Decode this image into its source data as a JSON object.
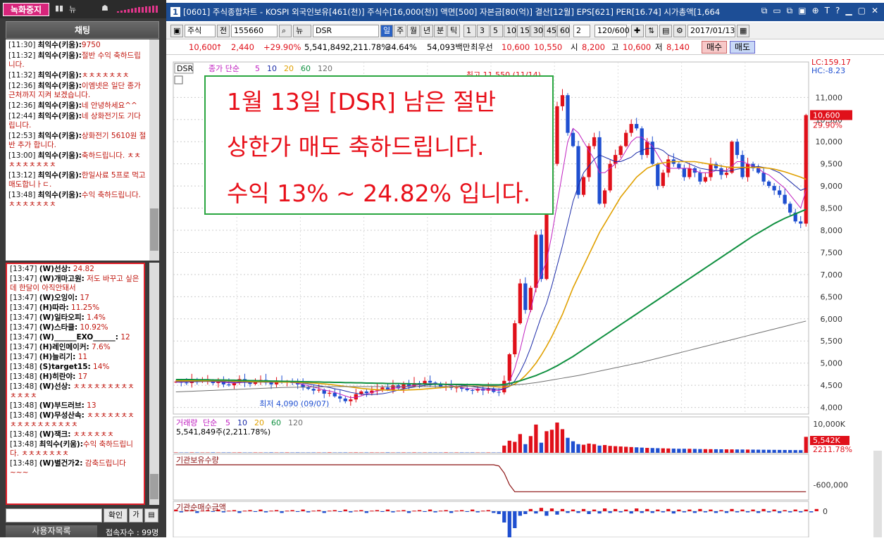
{
  "left_panel": {
    "record_button": "녹화중지",
    "top_icons": [
      "▮▮",
      "뉴",
      "☗"
    ],
    "chat_header": "채팅",
    "chat_messages": [
      {
        "time": "[11:30]",
        "name": "최익수(키움):",
        "text": "9750"
      },
      {
        "time": "[11:32]",
        "name": "최익수(키움):",
        "text": "절반 수익 축하드립니다."
      },
      {
        "time": "[11:32]",
        "name": "최익수(키움):",
        "text": "ㅊㅊㅊㅊㅊㅊㅊ"
      },
      {
        "time": "[12:36]",
        "name": "최익수(키움):",
        "text": "이엠넷은 일단 종가 근처까지 지켜 보겠습니다."
      },
      {
        "time": "[12:36]",
        "name": "최익수(키움):",
        "text": "네 안녕하세요^^"
      },
      {
        "time": "[12:44]",
        "name": "최익수(키움):",
        "text": "네 상화전기도 기다립니다."
      },
      {
        "time": "[12:53]",
        "name": "최익수(키움):",
        "text": "상화전기 5610원 절반 추가 합니다."
      },
      {
        "time": "[13:00]",
        "name": "최익수(키움):",
        "text": "축하드립니다. ㅊㅊㅊㅊㅊㅊㅊㅊㅊ"
      },
      {
        "time": "[13:12]",
        "name": "최익수(키움):",
        "text": "한일사료 5프로 먹고 매도합니ㅏㄷ."
      },
      {
        "time": "[13:48]",
        "name": "최익수(키움):",
        "text": "수익 축하드립니다. ㅊㅊㅊㅊㅊㅊㅊ"
      }
    ],
    "user_messages": [
      {
        "time": "[13:47]",
        "name": "(W)선상:",
        "text": " 24.82"
      },
      {
        "time": "[13:47]",
        "name": "(W)개마고원:",
        "text": " 저도 바꾸고 싶은데 한달이 아직안돼서"
      },
      {
        "time": "[13:47]",
        "name": "(W)오잉이:",
        "text": " 17"
      },
      {
        "time": "[13:47]",
        "name": "(H)따라:",
        "text": " 11.25%"
      },
      {
        "time": "[13:47]",
        "name": "(W)일타오피:",
        "text": " 1.4%"
      },
      {
        "time": "[13:47]",
        "name": "(W)스타클:",
        "text": " 10.92%"
      },
      {
        "time": "[13:47]",
        "name": "(W)______EXO______:",
        "text": " 12"
      },
      {
        "time": "[13:47]",
        "name": "(H)레인메이커:",
        "text": " 7.6%"
      },
      {
        "time": "[13:47]",
        "name": "(H)늘리기:",
        "text": " 11"
      },
      {
        "time": "[13:48]",
        "name": "(S)target15:",
        "text": " 14%"
      },
      {
        "time": "[13:48]",
        "name": "(H)히란야:",
        "text": " 17"
      },
      {
        "time": "[13:48]",
        "name": "(W)선상:",
        "text": " ㅊㅊㅊㅊㅊㅊㅊㅊㅊㅊㅊㅊㅊ"
      },
      {
        "time": "[13:48]",
        "name": "(W)부드러브:",
        "text": " 13"
      },
      {
        "time": "[13:48]",
        "name": "(W)무성산속:",
        "text": " ㅊㅊㅊㅊㅊㅊㅊㅊㅊㅊㅊㅊㅊㅊㅊㅊㅊ"
      },
      {
        "time": "[13:48]",
        "name": "(W)잭크:",
        "text": " ㅊㅊㅊㅊㅊㅊ"
      },
      {
        "time": "[13:48]",
        "name": "최익수(키움):",
        "text": "수익 축하드립니다. ㅊㅊㅊㅊㅊㅊㅊ",
        "red": true
      },
      {
        "time": "[13:48]",
        "name": "(W)별건가2:",
        "text": " 감축드립니다~~~"
      }
    ],
    "confirm_button": "확인",
    "small_buttons": [
      "가",
      "▤"
    ],
    "user_list_button": "사용자목록",
    "connection_count": "접속자수 : 99명"
  },
  "window": {
    "num": "1",
    "title": "[0601] 주식종합차트 - KOSPI 외국인보유[461(천)] 주식수[16,000(천)] 액면[500] 자본금[80(억)] 결산[12월] EPS[621] PER[16.74] 시가총액[1,664",
    "controls": [
      "⧉",
      "▭",
      "⧉",
      "▣",
      "⊕",
      "T",
      "?",
      "▁",
      "▢",
      "✕"
    ]
  },
  "toolbar": {
    "type_select": "주식",
    "jeon": "전",
    "code": "155660",
    "name": "DSR",
    "periods": [
      "일",
      "주",
      "월",
      "년",
      "분",
      "틱"
    ],
    "intervals": [
      "1",
      "3",
      "5",
      "10",
      "15",
      "30",
      "45",
      "60"
    ],
    "count_select": "2",
    "range": "120/600",
    "date": "2017/01/13"
  },
  "pricebar": {
    "price": "10,600",
    "arrow": "↑",
    "change": "2,440",
    "change_pct": "+29.90%",
    "volume": "5,541,849",
    "vol2": "2,211.78%",
    "vol3": "34.64%",
    "amount": "54,093백만",
    "best_ask_label": "최우선",
    "best_ask": "10,600",
    "best_bid": "10,550",
    "open_label": "시",
    "open": "8,200",
    "high_label": "고",
    "high": "10,600",
    "low_label": "저",
    "low": "8,140",
    "buy": "매수",
    "sell": "매도"
  },
  "callout": {
    "line1": "1월 13일 [DSR] 남은 절반",
    "line2": "상한가 매도 축하드립니다.",
    "line3": "수익 13% ~ 24.82% 입니다."
  },
  "chart_data": {
    "type": "candlestick",
    "symbol_tag": "DSR",
    "legend_label": "종가 단순",
    "ma_periods": [
      "5",
      "10",
      "20",
      "60",
      "120"
    ],
    "ma_colors": [
      "#c020c0",
      "#1a2aa8",
      "#e0a000",
      "#109040",
      "#707070"
    ],
    "price_ticks": [
      "11,000",
      "10,500",
      "10,000",
      "9,500",
      "9,000",
      "8,500",
      "8,000",
      "7,500",
      "7,000",
      "6,500",
      "6,000",
      "5,500",
      "5,000",
      "4,500",
      "4,000"
    ],
    "price_ylim": [
      3850,
      11800
    ],
    "high_annotation": "최고 11,550 (11/14)",
    "low_annotation": "최저 4,090 (09/07)",
    "lc_label": "LC:159.17",
    "hc_label": "HC:-8.23",
    "last_price_label": "10,600",
    "last_pct_label": "29.90%",
    "closes": [
      4580,
      4560,
      4550,
      4620,
      4580,
      4600,
      4610,
      4550,
      4600,
      4520,
      4500,
      4560,
      4640,
      4560,
      4530,
      4590,
      4620,
      4560,
      4520,
      4600,
      4560,
      4590,
      4550,
      4520,
      4450,
      4420,
      4380,
      4400,
      4310,
      4330,
      4250,
      4200,
      4140,
      4180,
      4300,
      4360,
      4320,
      4380,
      4410,
      4450,
      4400,
      4500,
      4430,
      4520,
      4480,
      4550,
      4520,
      4600,
      4560,
      4510,
      4460,
      4480,
      4440,
      4450,
      4420,
      4390,
      4380,
      4420,
      4380,
      4420,
      4350,
      4340,
      4600,
      5200,
      5900,
      6800,
      6200,
      6700,
      7900,
      6900,
      8500,
      9500,
      10800,
      11050,
      10200,
      9900,
      8800,
      9200,
      9900,
      10100,
      8600,
      8900,
      9500,
      9700,
      9900,
      10200,
      10400,
      10300,
      9700,
      10000,
      9500,
      9000,
      9300,
      9600,
      9500,
      9400,
      9200,
      9400,
      9300,
      9100,
      9200,
      9500,
      9400,
      9250,
      9300,
      10000,
      9700,
      9200,
      9500,
      9400,
      9300,
      9100,
      9000,
      8900,
      8800,
      8600,
      8400,
      8200,
      8150,
      10600
    ],
    "ma5": [
      4570,
      4570,
      4575,
      4580,
      4585,
      4590,
      4590,
      4580,
      4580,
      4570,
      4555,
      4550,
      4560,
      4565,
      4565,
      4580,
      4590,
      4575,
      4565,
      4570,
      4570,
      4570,
      4560,
      4550,
      4520,
      4490,
      4460,
      4430,
      4390,
      4370,
      4340,
      4300,
      4260,
      4220,
      4230,
      4260,
      4300,
      4340,
      4370,
      4390,
      4400,
      4430,
      4450,
      4470,
      4480,
      4500,
      4510,
      4530,
      4540,
      4540,
      4530,
      4520,
      4490,
      4470,
      4450,
      4430,
      4420,
      4410,
      4400,
      4400,
      4390,
      4380,
      4420,
      4580,
      4880,
      5300,
      5800,
      6200,
      6700,
      7000,
      7300,
      7900,
      8600,
      9300,
      10000,
      10300,
      10200,
      10000,
      9800,
      9600,
      9300,
      9300,
      9400,
      9500,
      9600,
      9800,
      10000,
      10100,
      10100,
      10000,
      9900,
      9700,
      9500,
      9400,
      9400,
      9400,
      9400,
      9400,
      9350,
      9300,
      9300,
      9300,
      9350,
      9350,
      9350,
      9450,
      9550,
      9550,
      9500,
      9450,
      9400,
      9300,
      9250,
      9150,
      9050,
      8950,
      8800,
      8650,
      8500,
      8900
    ],
    "ma10": [
      4580,
      4580,
      4580,
      4580,
      4580,
      4585,
      4585,
      4585,
      4585,
      4580,
      4575,
      4570,
      4570,
      4570,
      4570,
      4570,
      4570,
      4570,
      4570,
      4570,
      4570,
      4570,
      4570,
      4560,
      4550,
      4530,
      4510,
      4490,
      4470,
      4450,
      4420,
      4400,
      4370,
      4340,
      4320,
      4300,
      4290,
      4290,
      4300,
      4310,
      4330,
      4360,
      4390,
      4420,
      4440,
      4460,
      4480,
      4500,
      4510,
      4520,
      4520,
      4520,
      4520,
      4510,
      4500,
      4490,
      4470,
      4450,
      4440,
      4430,
      4420,
      4410,
      4420,
      4470,
      4600,
      4800,
      5050,
      5350,
      5700,
      6050,
      6350,
      6750,
      7200,
      7650,
      8150,
      8650,
      9000,
      9300,
      9450,
      9600,
      9700,
      9650,
      9600,
      9550,
      9550,
      9600,
      9650,
      9750,
      9800,
      9850,
      9850,
      9850,
      9800,
      9700,
      9650,
      9600,
      9550,
      9500,
      9450,
      9400,
      9380,
      9360,
      9350,
      9340,
      9330,
      9350,
      9380,
      9400,
      9420,
      9430,
      9440,
      9420,
      9400,
      9350,
      9300,
      9200,
      9100,
      9000,
      8900,
      8950
    ],
    "ma20": [
      4600,
      4600,
      4600,
      4600,
      4600,
      4600,
      4600,
      4600,
      4600,
      4600,
      4600,
      4590,
      4590,
      4590,
      4580,
      4580,
      4580,
      4580,
      4580,
      4575,
      4570,
      4570,
      4570,
      4565,
      4560,
      4555,
      4550,
      4540,
      4530,
      4520,
      4505,
      4490,
      4475,
      4460,
      4445,
      4430,
      4420,
      4410,
      4400,
      4395,
      4390,
      4390,
      4390,
      4390,
      4395,
      4400,
      4405,
      4415,
      4425,
      4435,
      4445,
      4455,
      4465,
      4470,
      4475,
      4480,
      4480,
      4480,
      4480,
      4480,
      4470,
      4460,
      4460,
      4480,
      4530,
      4610,
      4720,
      4850,
      5000,
      5180,
      5380,
      5600,
      5850,
      6100,
      6400,
      6700,
      6950,
      7200,
      7450,
      7700,
      7950,
      8150,
      8350,
      8550,
      8750,
      8900,
      9050,
      9200,
      9300,
      9400,
      9450,
      9500,
      9520,
      9540,
      9550,
      9550,
      9550,
      9550,
      9550,
      9530,
      9510,
      9490,
      9470,
      9450,
      9430,
      9420,
      9420,
      9420,
      9420,
      9420,
      9420,
      9410,
      9400,
      9380,
      9350,
      9320,
      9280,
      9240,
      9200,
      9150
    ],
    "ma60": [
      4630,
      4630,
      4630,
      4630,
      4625,
      4625,
      4625,
      4620,
      4620,
      4620,
      4615,
      4615,
      4610,
      4610,
      4605,
      4605,
      4600,
      4600,
      4595,
      4595,
      4590,
      4590,
      4585,
      4585,
      4580,
      4580,
      4575,
      4575,
      4570,
      4570,
      4565,
      4565,
      4560,
      4560,
      4555,
      4555,
      4550,
      4550,
      4545,
      4545,
      4540,
      4540,
      4540,
      4535,
      4535,
      4530,
      4530,
      4530,
      4525,
      4525,
      4525,
      4520,
      4520,
      4520,
      4520,
      4515,
      4515,
      4515,
      4510,
      4510,
      4510,
      4510,
      4520,
      4540,
      4570,
      4600,
      4640,
      4680,
      4720,
      4770,
      4820,
      4880,
      4940,
      5010,
      5080,
      5150,
      5230,
      5310,
      5390,
      5470,
      5550,
      5630,
      5710,
      5790,
      5870,
      5950,
      6030,
      6110,
      6190,
      6270,
      6350,
      6430,
      6510,
      6590,
      6670,
      6750,
      6830,
      6910,
      6990,
      7070,
      7150,
      7230,
      7310,
      7390,
      7470,
      7550,
      7630,
      7710,
      7790,
      7870,
      7940,
      8010,
      8080,
      8150,
      8210,
      8270,
      8320,
      8370,
      8420,
      8470
    ],
    "ma120": [
      4350,
      4355,
      4360,
      4365,
      4370,
      4375,
      4380,
      4385,
      4390,
      4395,
      4400,
      4405,
      4410,
      4415,
      4420,
      4425,
      4430,
      4435,
      4440,
      4445,
      4450,
      4452,
      4454,
      4456,
      4458,
      4460,
      4462,
      4464,
      4466,
      4468,
      4470,
      4470,
      4470,
      4470,
      4470,
      4470,
      4470,
      4470,
      4470,
      4470,
      4470,
      4470,
      4470,
      4470,
      4470,
      4470,
      4470,
      4470,
      4470,
      4470,
      4470,
      4470,
      4472,
      4474,
      4476,
      4478,
      4480,
      4482,
      4484,
      4486,
      4488,
      4490,
      4495,
      4500,
      4510,
      4520,
      4530,
      4545,
      4560,
      4580,
      4600,
      4620,
      4640,
      4660,
      4680,
      4700,
      4720,
      4745,
      4770,
      4795,
      4820,
      4845,
      4870,
      4895,
      4920,
      4945,
      4970,
      4995,
      5020,
      5050,
      5080,
      5110,
      5140,
      5170,
      5200,
      5230,
      5260,
      5290,
      5320,
      5350,
      5380,
      5410,
      5440,
      5470,
      5500,
      5530,
      5560,
      5590,
      5620,
      5650,
      5680,
      5710,
      5740,
      5770,
      5800,
      5830,
      5860,
      5890,
      5920,
      5950
    ],
    "volume_title": "거래량",
    "volume_legend": "단순",
    "volume_ma_periods": [
      "5",
      "10",
      "20",
      "60",
      "120"
    ],
    "volume_value": "5,541,849주(2,211.78%)",
    "volume_ticks": [
      "10,000K"
    ],
    "volume_last_label": "5,542K",
    "volume_last_pct": "2211.78%",
    "volumes": [
      120,
      90,
      100,
      130,
      110,
      95,
      100,
      140,
      90,
      110,
      120,
      100,
      130,
      90,
      100,
      110,
      95,
      100,
      140,
      90,
      110,
      120,
      100,
      130,
      90,
      100,
      110,
      95,
      100,
      140,
      90,
      110,
      120,
      100,
      130,
      90,
      100,
      110,
      95,
      100,
      140,
      90,
      110,
      120,
      100,
      130,
      90,
      100,
      110,
      95,
      100,
      140,
      90,
      110,
      120,
      100,
      130,
      90,
      100,
      110,
      95,
      100,
      2500,
      4200,
      3800,
      6500,
      3000,
      5800,
      9800,
      3500,
      7500,
      8000,
      10500,
      8200,
      5200,
      4000,
      3000,
      2800,
      3200,
      3000,
      2500,
      2700,
      2400,
      2300,
      2200,
      2100,
      2000,
      1900,
      1800,
      1700,
      1650,
      1600,
      1550,
      1500,
      1450,
      1400,
      1400,
      1380,
      1350,
      1300,
      1280,
      1260,
      1240,
      1220,
      1200,
      1180,
      1160,
      1140,
      1120,
      1100,
      1080,
      1060,
      1040,
      1020,
      1000,
      980,
      960,
      940,
      920,
      5542
    ],
    "inst_title": "기관보유수량",
    "inst_ticks": [
      "-600,000",
      "0"
    ],
    "inst_values": [
      -260000,
      -260000,
      -260000,
      -260000,
      -260000,
      -260000,
      -260000,
      -260000,
      -260000,
      -260000,
      -260000,
      -260000,
      -260000,
      -260000,
      -260000,
      -260000,
      -260000,
      -260000,
      -260000,
      -260000,
      -260000,
      -260000,
      -260000,
      -260000,
      -260000,
      -260000,
      -260000,
      -260000,
      -260000,
      -260000,
      -260000,
      -260000,
      -260000,
      -260000,
      -260000,
      -260000,
      -260000,
      -260000,
      -260000,
      -260000,
      -260000,
      -260000,
      -260000,
      -260000,
      -260000,
      -260000,
      -260000,
      -260000,
      -260000,
      -260000,
      -260000,
      -260000,
      -260000,
      -260000,
      -260000,
      -260000,
      -260000,
      -260000,
      -260000,
      -260000,
      -260000,
      -280000,
      -400000,
      -600000,
      -720000,
      -720000,
      -720000,
      -720000,
      -720000,
      -720000,
      -720000,
      -720000,
      -720000,
      -720000,
      -720000,
      -720000,
      -720000,
      -720000,
      -720000,
      -720000,
      -720000,
      -720000,
      -720000,
      -720000,
      -720000,
      -720000,
      -720000,
      -720000,
      -720000,
      -720000,
      -720000,
      -720000,
      -720000,
      -720000,
      -720000,
      -720000,
      -720000,
      -720000,
      -720000,
      -720000,
      -720000,
      -720000,
      -720000,
      -720000,
      -720000,
      -720000,
      -720000,
      -720000,
      -720000,
      -720000,
      -720000,
      -720000,
      -720000,
      -720000,
      -720000,
      -720000,
      -720000,
      -720000,
      -720000,
      -720000
    ],
    "inst_net_title": "기관순매수금액",
    "inst_net_tick": "0",
    "inst_net": [
      3,
      -2,
      1,
      2,
      -3,
      1,
      2,
      -1,
      3,
      -2,
      1,
      2,
      -3,
      1,
      2,
      -1,
      3,
      -2,
      1,
      2,
      -3,
      1,
      2,
      -1,
      3,
      -2,
      1,
      2,
      -3,
      1,
      2,
      -1,
      3,
      -2,
      1,
      2,
      -3,
      1,
      2,
      -1,
      3,
      -2,
      1,
      2,
      -3,
      1,
      2,
      -1,
      3,
      -2,
      1,
      2,
      -3,
      1,
      2,
      -1,
      3,
      -2,
      1,
      2,
      -3,
      -5,
      -20,
      -60,
      -30,
      -8,
      -5,
      4,
      -4,
      6,
      -8,
      5,
      -6,
      4,
      -3,
      3,
      -3,
      4,
      -5,
      3,
      -4,
      5,
      -3,
      4,
      -2,
      3,
      -4,
      5,
      -3,
      4,
      -3,
      3,
      -2,
      4,
      -4,
      3,
      -2,
      3,
      -3,
      4,
      -2,
      3,
      -3,
      2,
      -3,
      4,
      -2,
      3,
      -2,
      3,
      -3,
      4,
      -2,
      3,
      -3,
      2,
      -2,
      3,
      -2,
      3,
      -2,
      4
    ]
  }
}
